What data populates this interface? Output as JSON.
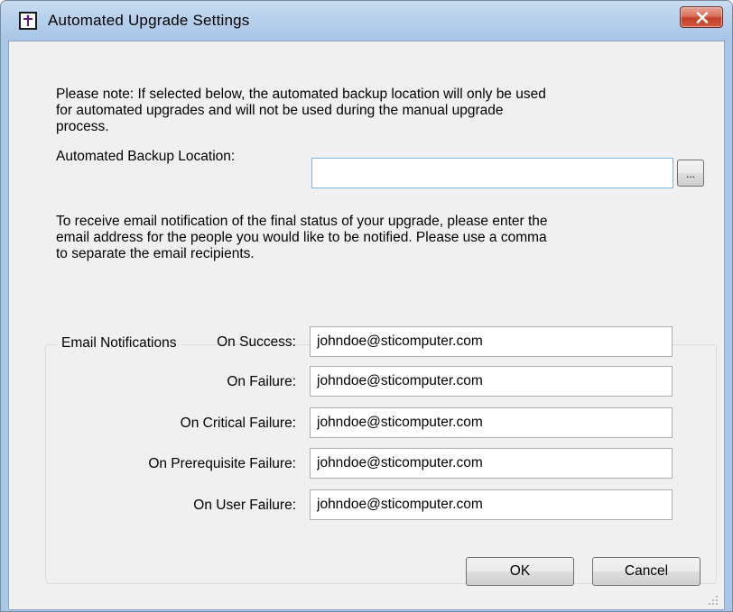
{
  "window": {
    "title": "Automated Upgrade Settings"
  },
  "note": {
    "lines": [
      "Please note: If selected below, the automated backup location will only be used",
      "for automated upgrades and will not be used during the manual upgrade",
      "process."
    ]
  },
  "backup": {
    "label": "Automated Backup Location:",
    "value": "",
    "browse_label": "..."
  },
  "email_info": {
    "lines": [
      "To receive email notification of the final status of your upgrade, please enter the",
      "email address for the people you would like to be notified.  Please use a comma",
      "to separate the email recipients."
    ]
  },
  "notifications": {
    "group_label": "Email Notifications",
    "fields": [
      {
        "label": "On Success:",
        "value": "johndoe@sticomputer.com"
      },
      {
        "label": "On Failure:",
        "value": "johndoe@sticomputer.com"
      },
      {
        "label": "On Critical Failure:",
        "value": "johndoe@sticomputer.com"
      },
      {
        "label": "On Prerequisite Failure:",
        "value": "johndoe@sticomputer.com"
      },
      {
        "label": "On User Failure:",
        "value": "johndoe@sticomputer.com"
      }
    ]
  },
  "buttons": {
    "ok": "OK",
    "cancel": "Cancel"
  },
  "icons": {
    "app": "app-cross-icon",
    "close": "close-icon",
    "grip": "resize-grip-icon"
  },
  "colors": {
    "title_bar": "#b7d0ec",
    "close_button": "#c3402a",
    "dialog_background": "#f0f0f0"
  }
}
